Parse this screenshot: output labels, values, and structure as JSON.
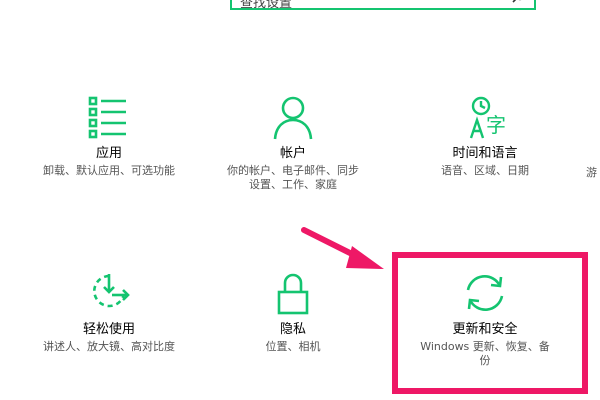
{
  "search": {
    "text": "查找设置"
  },
  "tiles": [
    {
      "title": "应用",
      "desc": [
        "卸载、默认应用、可选功能"
      ],
      "icon": "apps-list-icon"
    },
    {
      "title": "帐户",
      "desc": [
        "你的帐户、电子邮件、同步",
        "设置、工作、家庭"
      ],
      "icon": "person-icon"
    },
    {
      "title": "时间和语言",
      "desc": [
        "语音、区域、日期"
      ],
      "icon": "time-language-icon"
    },
    {
      "title": "轻松使用",
      "desc": [
        "讲述人、放大镜、高对比度"
      ],
      "icon": "ease-of-access-icon"
    },
    {
      "title": "隐私",
      "desc": [
        "位置、相机"
      ],
      "icon": "lock-icon"
    },
    {
      "title": "更新和安全",
      "desc": [
        "Windows 更新、恢复、备",
        "份"
      ],
      "icon": "sync-icon"
    }
  ],
  "partial_tile": {
    "title": "",
    "desc": "游"
  },
  "colors": {
    "accent": "#14c470",
    "highlight": "#ee1866"
  }
}
